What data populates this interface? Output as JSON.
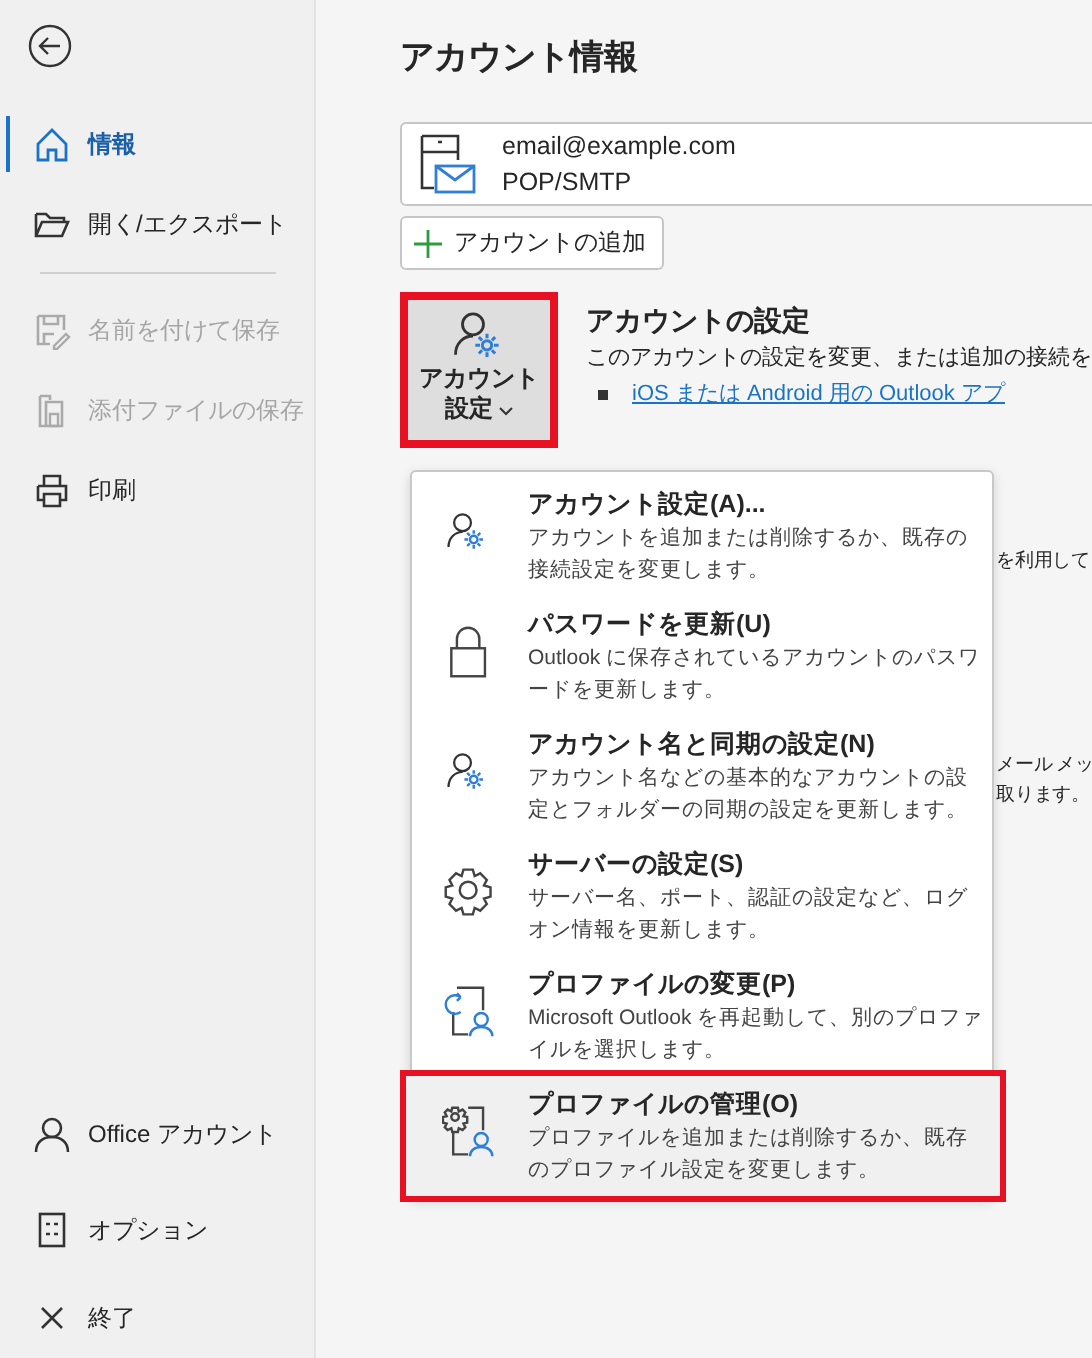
{
  "sidebar": {
    "items": [
      {
        "label": "情報",
        "selected": true,
        "disabled": false
      },
      {
        "label": "開く/エクスポート",
        "selected": false,
        "disabled": false
      },
      {
        "label": "名前を付けて保存",
        "selected": false,
        "disabled": true
      },
      {
        "label": "添付ファイルの保存",
        "selected": false,
        "disabled": true
      },
      {
        "label": "印刷",
        "selected": false,
        "disabled": false
      }
    ],
    "footer_items": [
      {
        "label": "Office アカウント"
      },
      {
        "label": "オプション"
      },
      {
        "label": "終了"
      }
    ]
  },
  "page_title": "アカウント情報",
  "account": {
    "email": "email@example.com",
    "type": "POP/SMTP"
  },
  "add_account_button": "アカウントの追加",
  "account_settings": {
    "button_label": "アカウント設定",
    "highlighted": true,
    "heading": "アカウントの設定",
    "description": "このアカウントの設定を変更、または追加の接続を",
    "link": "iOS または Android 用の Outlook アプ"
  },
  "partial_texts": [
    "を利用して",
    "メール メッ",
    "取ります。"
  ],
  "menu": {
    "items": [
      {
        "title": "アカウント設定(A)...",
        "description": "アカウントを追加または削除するか、既存の接続設定を変更します。",
        "highlighted": false
      },
      {
        "title": "パスワードを更新(U)",
        "description": "Outlook に保存されているアカウントのパスワードを更新します。",
        "highlighted": false
      },
      {
        "title": "アカウント名と同期の設定(N)",
        "description": "アカウント名などの基本的なアカウントの設定とフォルダーの同期の設定を更新します。",
        "highlighted": false
      },
      {
        "title": "サーバーの設定(S)",
        "description": "サーバー名、ポート、認証の設定など、ログオン情報を更新します。",
        "highlighted": false
      },
      {
        "title": "プロファイルの変更(P)",
        "description": "Microsoft Outlook を再起動して、別のプロファイルを選択します。",
        "highlighted": false
      },
      {
        "title": "プロファイルの管理(O)",
        "description": "プロファイルを追加または削除するか、既存のプロファイル設定を変更します。",
        "highlighted": true
      }
    ]
  }
}
